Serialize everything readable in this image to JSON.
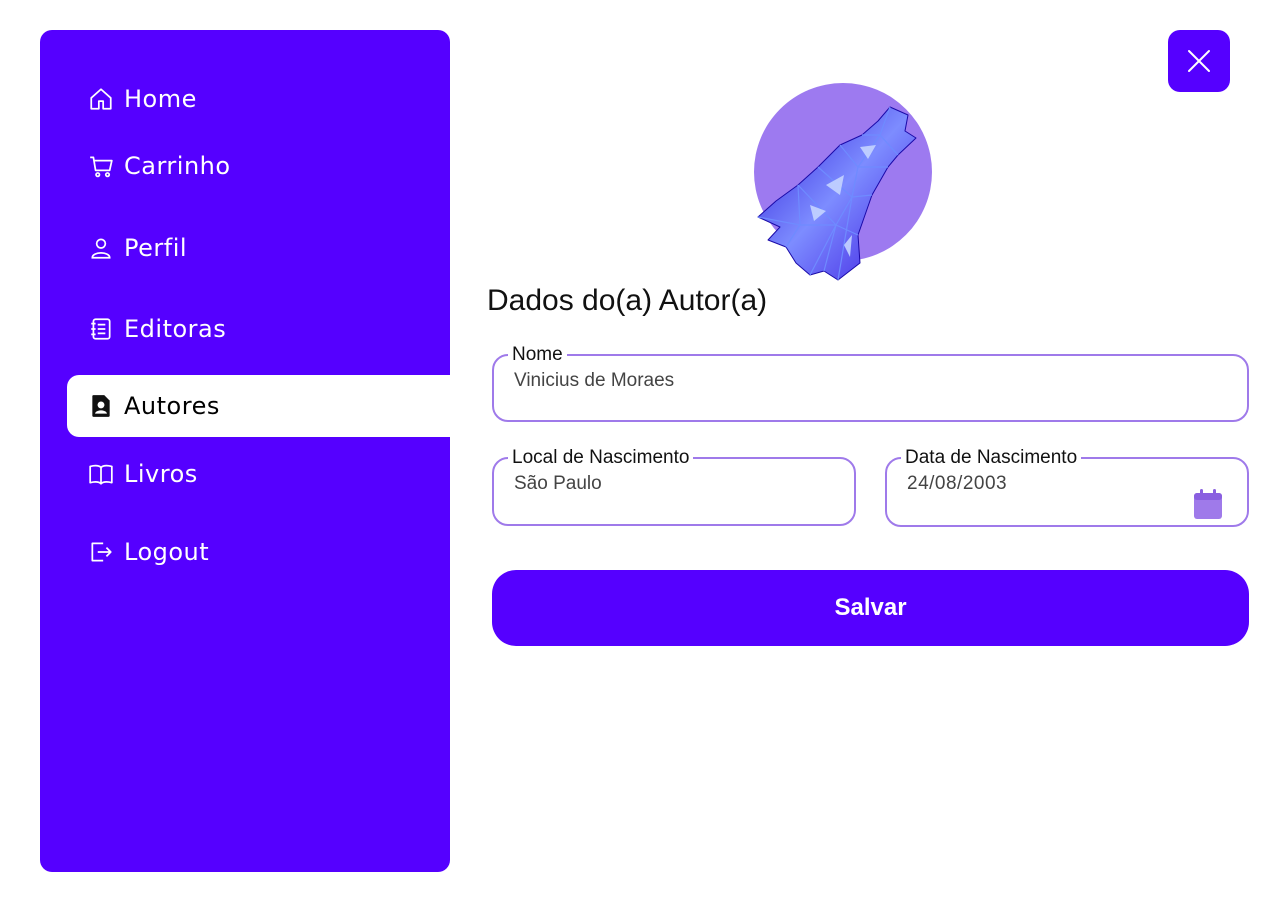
{
  "sidebar": {
    "items": [
      {
        "label": "Home",
        "icon": "home-icon"
      },
      {
        "label": "Carrinho",
        "icon": "cart-icon"
      },
      {
        "label": "Perfil",
        "icon": "user-icon"
      },
      {
        "label": "Editoras",
        "icon": "notebook-icon"
      },
      {
        "label": "Autores",
        "icon": "author-badge-icon",
        "active": true
      },
      {
        "label": "Livros",
        "icon": "book-icon"
      },
      {
        "label": "Logout",
        "icon": "logout-icon"
      }
    ]
  },
  "header": {
    "close_icon": "close-icon"
  },
  "form": {
    "title": "Dados do(a) Autor(a)",
    "nome": {
      "label": "Nome",
      "value": "Vinicius de Moraes"
    },
    "local": {
      "label": "Local de Nascimento",
      "value": "São Paulo"
    },
    "data": {
      "label": "Data de Nascimento",
      "value": "24/08/2003",
      "icon": "calendar-icon"
    },
    "save_label": "Salvar"
  },
  "colors": {
    "accent": "#5500ff",
    "border": "#9f7aea",
    "avatar_circle": "#9d7af0"
  }
}
